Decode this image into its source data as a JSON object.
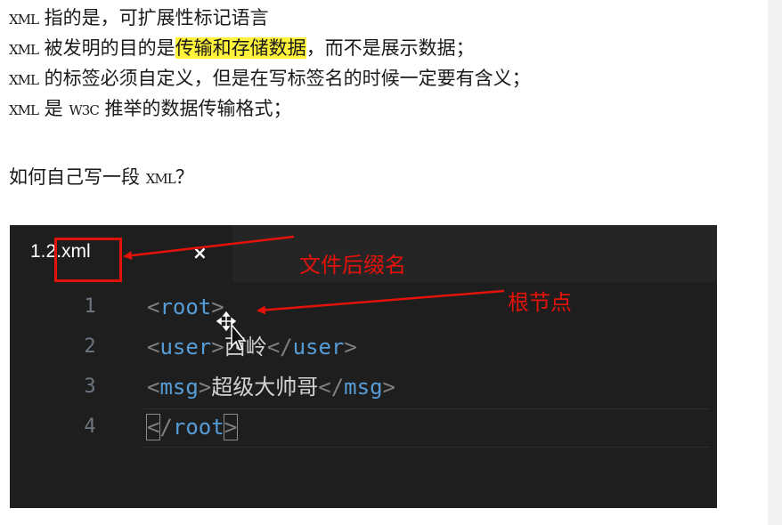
{
  "intro": {
    "lines": [
      {
        "kw": "XML",
        "text": " 指的是，可扩展性标记语言"
      },
      {
        "kw": "XML",
        "text": " 被发明的目的是",
        "highlight": "传输和存储数据",
        "after": "，而不是展示数据；"
      },
      {
        "kw": "XML",
        "text": " 的标签必须自定义，但是在写标签名的时候一定要有含义；"
      },
      {
        "kw": "XML",
        "text": " 是 ",
        "kw2": "W3C",
        "text2": " 推举的数据传输格式；"
      }
    ],
    "question_before": "如何自己写一段 ",
    "question_kw": "XML",
    "question_after": "？"
  },
  "editor": {
    "tab_name": "1.2.xml",
    "tab_close": "×",
    "line_numbers": [
      "1",
      "2",
      "3",
      "4"
    ],
    "lines": [
      {
        "open": "root",
        "text": "",
        "close": ""
      },
      {
        "open": "user",
        "text": "西岭",
        "close": "user"
      },
      {
        "open": "msg",
        "text": "超级大帅哥",
        "close": "msg"
      },
      {
        "open": "",
        "text": "",
        "close": "root"
      }
    ]
  },
  "annotations": {
    "suffix_label": "文件后缀名",
    "root_label": "根节点",
    "color": "#e3120b"
  },
  "colors": {
    "highlight": "#fff23a",
    "tag": "#569cd6",
    "punctuation": "#808080",
    "editor_bg": "#1e1e1e"
  }
}
